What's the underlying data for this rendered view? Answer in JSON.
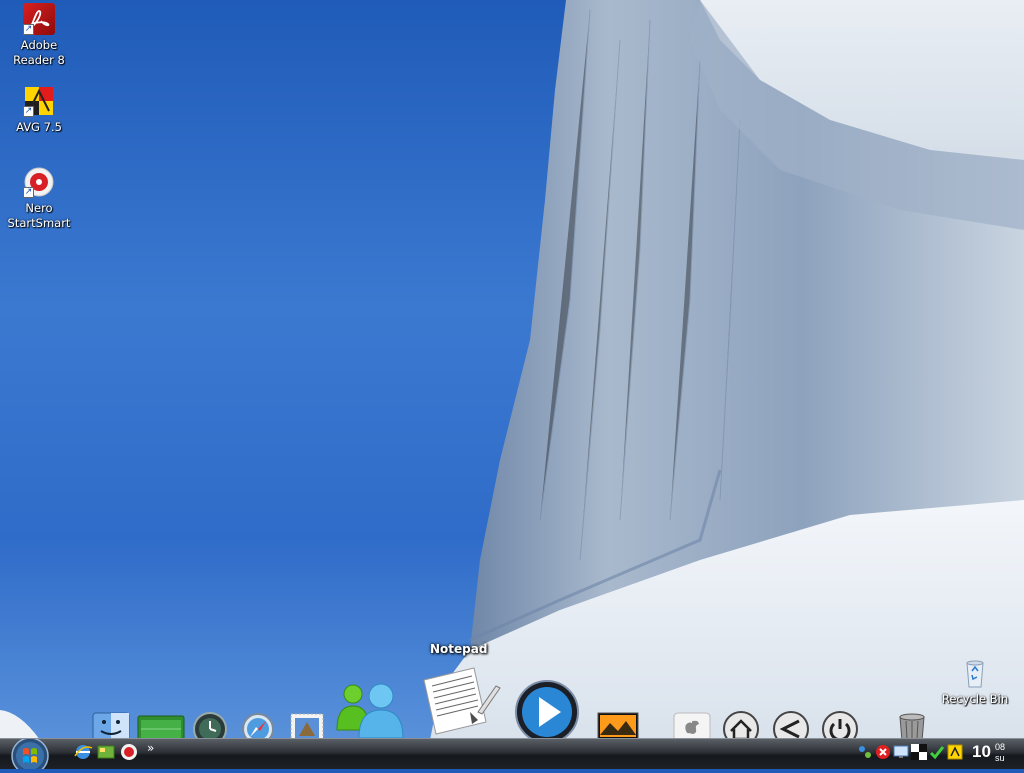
{
  "desktop": {
    "icons": [
      {
        "label": "Adobe Reader 8"
      },
      {
        "label": "AVG 7.5"
      },
      {
        "label": "Nero StartSmart"
      }
    ],
    "recycle_bin": {
      "label": "Recycle Bin"
    }
  },
  "dock": {
    "tooltip": "Notepad",
    "items": [
      {
        "icon": "finder-icon"
      },
      {
        "icon": "green-folder-icon"
      },
      {
        "icon": "time-machine-icon"
      },
      {
        "icon": "safari-icon"
      },
      {
        "icon": "mail-stamp-icon"
      },
      {
        "icon": "messenger-icon"
      },
      {
        "icon": "notepad-icon"
      },
      {
        "icon": "media-player-icon"
      },
      {
        "icon": "photo-icon"
      },
      {
        "icon": "apple-icon"
      },
      {
        "icon": "home-icon"
      },
      {
        "icon": "back-icon"
      },
      {
        "icon": "power-icon"
      },
      {
        "icon": "trash-icon"
      }
    ]
  },
  "taskbar": {
    "quick_launch_more": "»",
    "clock": {
      "hours": "10",
      "minutes": "08",
      "day": "su"
    }
  },
  "colors": {
    "sky_top": "#1f5bb8",
    "taskbar_dark": "#15181c",
    "ice": "#e8edf3"
  }
}
